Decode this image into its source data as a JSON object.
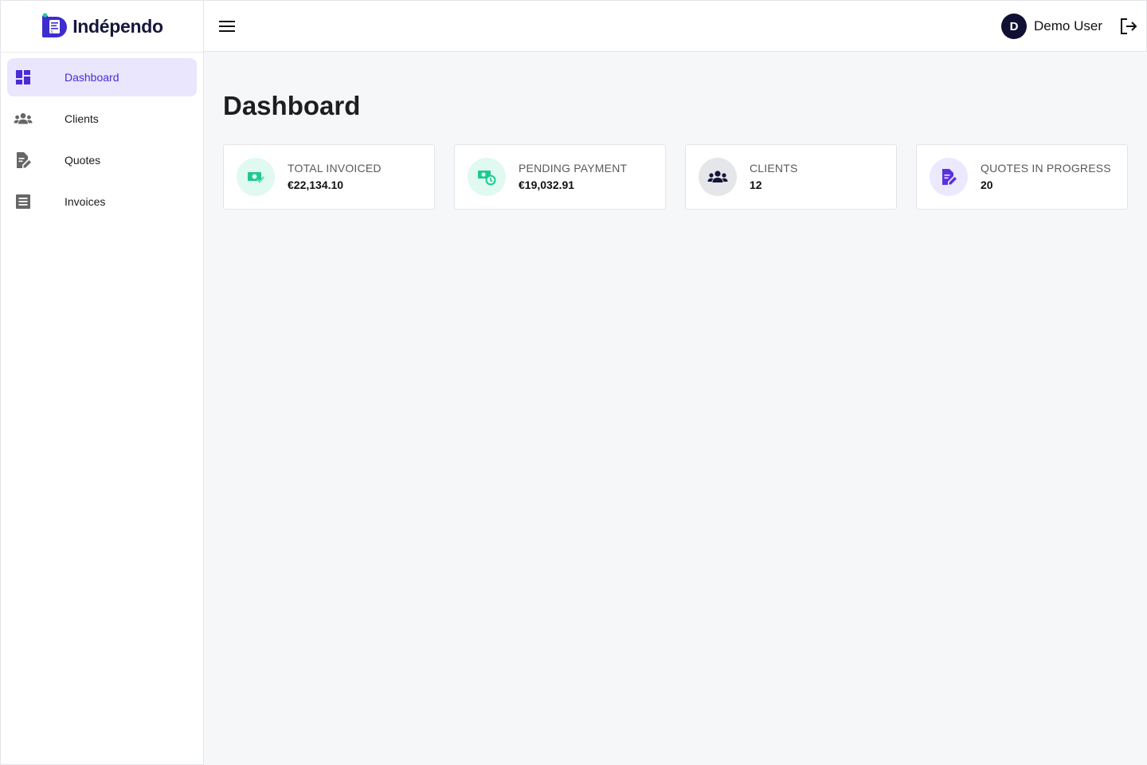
{
  "app": {
    "name": "Indépendo"
  },
  "sidebar": {
    "items": [
      {
        "label": "Dashboard",
        "icon": "dashboard-icon",
        "active": true
      },
      {
        "label": "Clients",
        "icon": "people-icon",
        "active": false
      },
      {
        "label": "Quotes",
        "icon": "edit-document-icon",
        "active": false
      },
      {
        "label": "Invoices",
        "icon": "receipt-icon",
        "active": false
      }
    ]
  },
  "header": {
    "user_initial": "D",
    "user_name": "Demo User"
  },
  "main": {
    "title": "Dashboard",
    "stats": [
      {
        "label": "TOTAL INVOICED",
        "value": "€22,134.10",
        "icon": "money-check-icon",
        "icon_bg": "#e0f9f1",
        "icon_color": "#1fc98e"
      },
      {
        "label": "PENDING PAYMENT",
        "value": "€19,032.91",
        "icon": "money-clock-icon",
        "icon_bg": "#e0f9f1",
        "icon_color": "#1fc98e"
      },
      {
        "label": "CLIENTS",
        "value": "12",
        "icon": "people-icon",
        "icon_bg": "#e5e6ea",
        "icon_color": "#14163a"
      },
      {
        "label": "QUOTES IN PROGRESS",
        "value": "20",
        "icon": "edit-document-icon",
        "icon_bg": "#ece8fd",
        "icon_color": "#5a31e0"
      }
    ]
  },
  "colors": {
    "accent": "#4a2bd6",
    "active_bg": "#e9e6fd",
    "brand_dark": "#15173a"
  }
}
